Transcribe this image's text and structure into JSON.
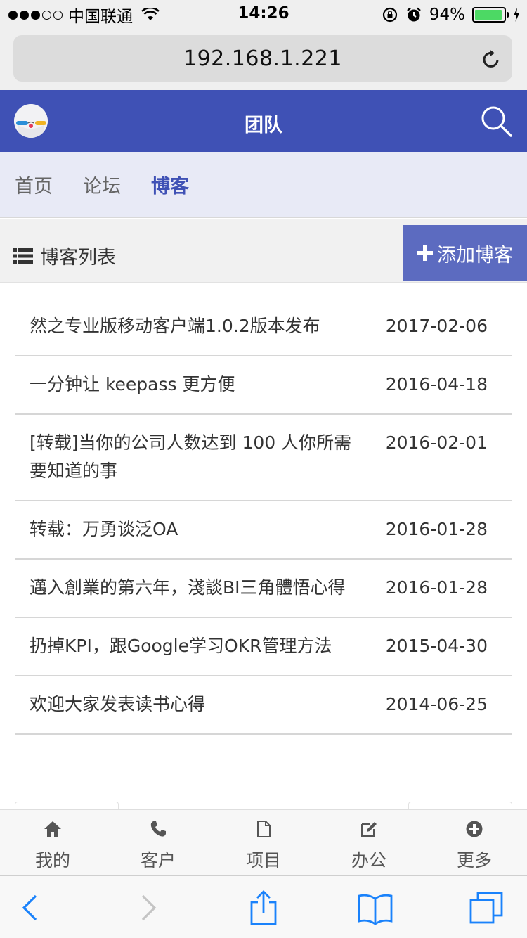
{
  "status_bar": {
    "carrier": "中国联通",
    "time": "14:26",
    "battery_percent": "94%",
    "battery_level": 0.94,
    "signal_bars_filled": 3,
    "signal_bars_total": 5
  },
  "browser": {
    "url": "192.168.1.221"
  },
  "header": {
    "title": "团队"
  },
  "nav_tabs": [
    {
      "label": "首页",
      "active": false
    },
    {
      "label": "论坛",
      "active": false
    },
    {
      "label": "博客",
      "active": true
    }
  ],
  "list_header": {
    "title": "博客列表",
    "add_button": "添加博客"
  },
  "blogs": [
    {
      "title": "然之专业版移动客户端1.0.2版本发布",
      "date": "2017-02-06"
    },
    {
      "title": "一分钟让 keepass 更方便",
      "date": "2016-04-18"
    },
    {
      "title": "[转载]当你的公司人数达到 100 人你所需要知道的事",
      "date": "2016-02-01"
    },
    {
      "title": "转载：万勇谈泛OA",
      "date": "2016-01-28"
    },
    {
      "title": "邁入創業的第六年，淺談BI三角體悟心得",
      "date": "2016-01-28"
    },
    {
      "title": "扔掉KPI，跟Google学习OKR管理方法",
      "date": "2015-04-30"
    },
    {
      "title": "欢迎大家发表读书心得",
      "date": "2014-06-25"
    }
  ],
  "bottom_nav": [
    {
      "label": "我的",
      "icon": "home-icon"
    },
    {
      "label": "客户",
      "icon": "phone-icon"
    },
    {
      "label": "项目",
      "icon": "file-icon"
    },
    {
      "label": "办公",
      "icon": "edit-icon"
    },
    {
      "label": "更多",
      "icon": "plus-circle-icon"
    }
  ],
  "colors": {
    "primary": "#3f51b5",
    "nav_bg": "#e8eaf6",
    "add_button": "#5c6bc0",
    "ios_blue": "#1a82fb"
  }
}
